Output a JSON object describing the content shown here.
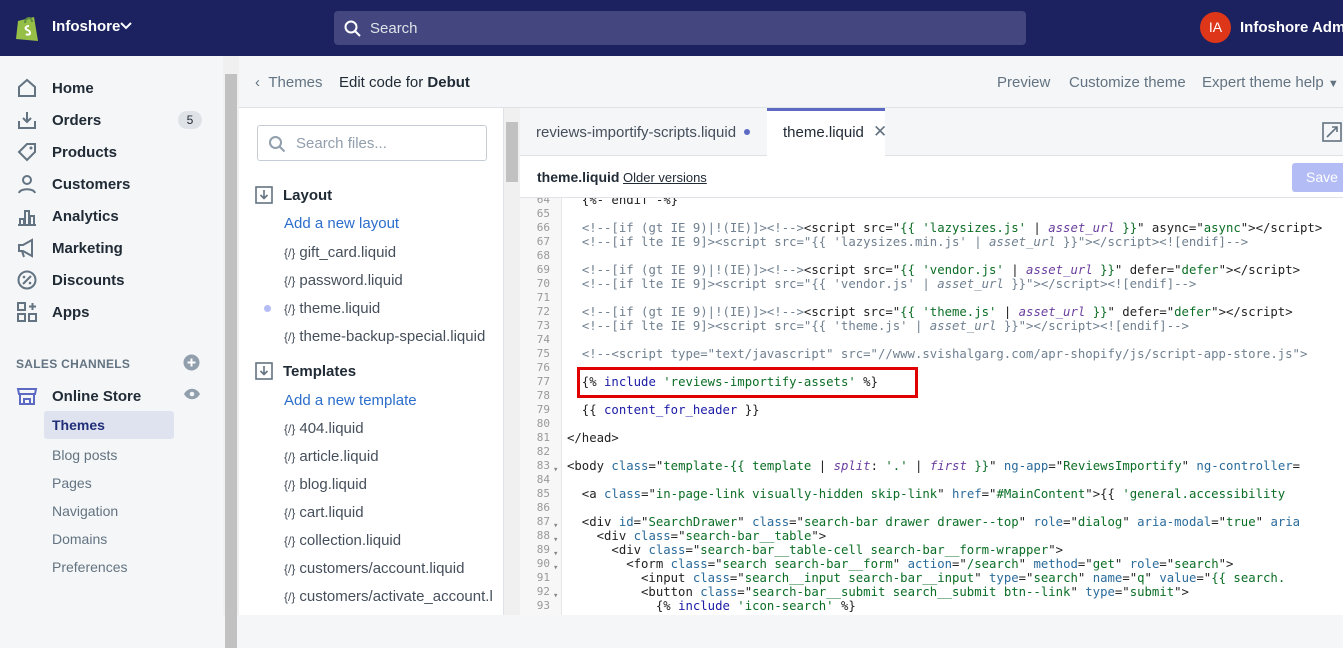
{
  "topbar": {
    "store_name": "Infoshore",
    "search_placeholder": "Search",
    "avatar_initials": "IA",
    "admin_name": "Infoshore Admin"
  },
  "nav": {
    "items": [
      {
        "label": "Home",
        "icon": "home-icon"
      },
      {
        "label": "Orders",
        "icon": "orders-icon",
        "badge": "5"
      },
      {
        "label": "Products",
        "icon": "tag-icon"
      },
      {
        "label": "Customers",
        "icon": "person-icon"
      },
      {
        "label": "Analytics",
        "icon": "chart-icon"
      },
      {
        "label": "Marketing",
        "icon": "megaphone-icon"
      },
      {
        "label": "Discounts",
        "icon": "discount-icon"
      },
      {
        "label": "Apps",
        "icon": "apps-icon"
      }
    ],
    "sales_channels_heading": "SALES CHANNELS",
    "online_store": "Online Store",
    "sub_items": [
      "Themes",
      "Blog posts",
      "Pages",
      "Navigation",
      "Domains",
      "Preferences"
    ]
  },
  "header": {
    "back_label": "Themes",
    "edit_prefix": "Edit code for",
    "theme_name": "Debut",
    "preview": "Preview",
    "customize": "Customize theme",
    "expert_help": "Expert theme help"
  },
  "files": {
    "search_placeholder": "Search files...",
    "layout_heading": "Layout",
    "add_layout": "Add a new layout",
    "layout_files": [
      "gift_card.liquid",
      "password.liquid",
      "theme.liquid",
      "theme-backup-special.liquid"
    ],
    "templates_heading": "Templates",
    "add_template": "Add a new template",
    "template_files": [
      "404.liquid",
      "article.liquid",
      "blog.liquid",
      "cart.liquid",
      "collection.liquid",
      "customers/account.liquid",
      "customers/activate_account.l"
    ]
  },
  "editor": {
    "tabs": [
      "reviews-importify-scripts.liquid",
      "theme.liquid"
    ],
    "filename": "theme.liquid",
    "older_versions": "Older versions",
    "save": "Save",
    "line_numbers": [
      "64",
      "65",
      "66",
      "67",
      "68",
      "69",
      "70",
      "71",
      "72",
      "73",
      "74",
      "75",
      "76",
      "77",
      "78",
      "79",
      "80",
      "81",
      "82",
      "83",
      "84",
      "85",
      "86",
      "87",
      "88",
      "89",
      "90",
      "91",
      "92",
      "93"
    ]
  }
}
